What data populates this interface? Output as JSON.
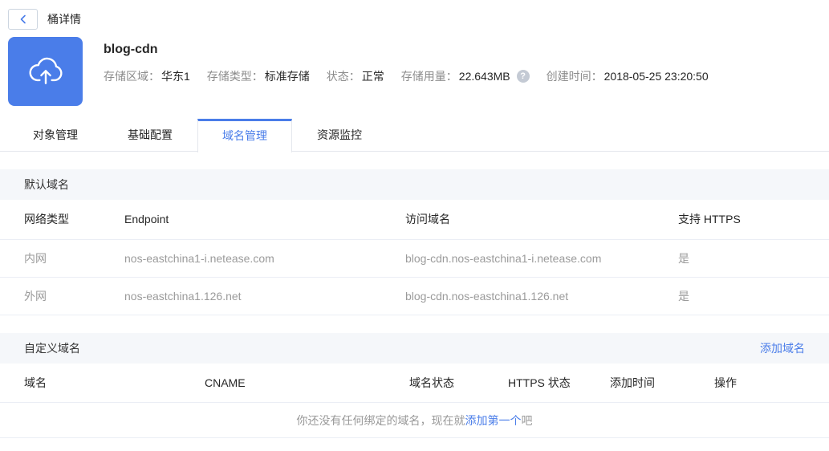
{
  "colors": {
    "accent": "#4a7de9",
    "section_bg": "#f5f7fa",
    "border": "#ebeef5",
    "muted_text": "#9b9b9b",
    "label_text": "#8c8c8c",
    "dark_text": "#262626"
  },
  "icons": {
    "back": "chevron-left",
    "bucket": "cloud-upload",
    "help": "question-mark",
    "help_glyph": "?"
  },
  "topbar": {
    "title": "桶详情"
  },
  "bucket": {
    "name": "blog-cdn",
    "info": [
      {
        "label": "存储区域：",
        "value": "华东1"
      },
      {
        "label": "存储类型：",
        "value": "标准存储"
      },
      {
        "label": "状态：",
        "value": "正常"
      },
      {
        "label": "存储用量：",
        "value": "22.643MB"
      },
      {
        "label": "创建时间：",
        "value": "2018-05-25 23:20:50"
      }
    ]
  },
  "tabs": [
    {
      "label": "对象管理",
      "active": false
    },
    {
      "label": "基础配置",
      "active": false
    },
    {
      "label": "域名管理",
      "active": true
    },
    {
      "label": "资源监控",
      "active": false
    }
  ],
  "default_domains": {
    "section_title": "默认域名",
    "columns": [
      "网络类型",
      "Endpoint",
      "访问域名",
      "支持 HTTPS"
    ],
    "rows": [
      [
        "内网",
        "nos-eastchina1-i.netease.com",
        "blog-cdn.nos-eastchina1-i.netease.com",
        "是"
      ],
      [
        "外网",
        "nos-eastchina1.126.net",
        "blog-cdn.nos-eastchina1.126.net",
        "是"
      ]
    ]
  },
  "custom_domains": {
    "section_title": "自定义域名",
    "add_button": "添加域名",
    "columns": [
      "域名",
      "CNAME",
      "域名状态",
      "HTTPS 状态",
      "添加时间",
      "操作"
    ],
    "empty_state": {
      "prefix": "你还没有任何绑定的域名，现在就",
      "link": "添加第一个",
      "suffix": "吧"
    }
  }
}
